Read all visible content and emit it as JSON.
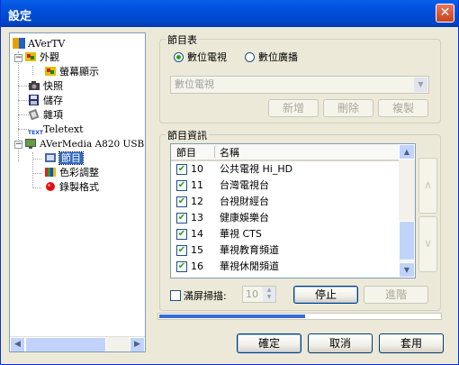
{
  "window": {
    "title": "設定"
  },
  "tree": {
    "items": [
      {
        "label": "AVerTV",
        "icon": "avertv-logo-icon"
      },
      {
        "label": "外觀",
        "icon": "appearance-icon"
      },
      {
        "label": "螢幕顯示",
        "icon": "osd-icon"
      },
      {
        "label": "快照",
        "icon": "camera-icon"
      },
      {
        "label": "儲存",
        "icon": "floppy-disk-icon"
      },
      {
        "label": "雜項",
        "icon": "tools-icon"
      },
      {
        "label": "Teletext",
        "icon": "text-icon"
      },
      {
        "label": "AVerMedia A820 USB",
        "icon": "tv-device-icon"
      },
      {
        "label": "節目",
        "icon": "program-icon"
      },
      {
        "label": "色彩調整",
        "icon": "color-bars-icon"
      },
      {
        "label": "錄製格式",
        "icon": "record-icon"
      }
    ],
    "selected_index": 8
  },
  "program_table": {
    "group_label": "節目表",
    "radio_digital_tv": "數位電視",
    "radio_digital_radio": "數位廣播",
    "selected_radio": "數位電視",
    "combo_value": "數位電視",
    "add_label": "新增",
    "delete_label": "刪除",
    "copy_label": "複製"
  },
  "program_info": {
    "group_label": "節目資訊",
    "columns": [
      "節目",
      "名稱"
    ],
    "rows": [
      {
        "num": "10",
        "name": "公共電視 Hi_HD",
        "checked": true
      },
      {
        "num": "11",
        "name": "台灣電視台",
        "checked": true
      },
      {
        "num": "12",
        "name": "台視財經台",
        "checked": true
      },
      {
        "num": "13",
        "name": "健康娛樂台",
        "checked": true
      },
      {
        "num": "14",
        "name": "華視 CTS",
        "checked": true
      },
      {
        "num": "15",
        "name": "華視教育頻道",
        "checked": true
      },
      {
        "num": "16",
        "name": "華視休閒頻道",
        "checked": true
      }
    ],
    "up_label": "∧",
    "down_label": "∨",
    "full_scan_label": "滿屏掃描:",
    "spin_value": "10",
    "stop_label": "停止",
    "advanced_label": "進階",
    "progress_fraction": 0.52
  },
  "footer": {
    "ok_label": "確定",
    "cancel_label": "取消",
    "apply_label": "套用"
  }
}
